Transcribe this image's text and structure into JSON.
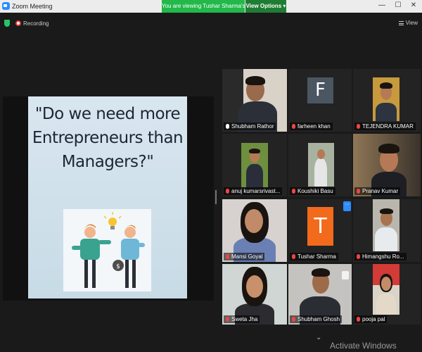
{
  "window": {
    "title": "Zoom Meeting",
    "controls": [
      "—",
      "☐",
      "✕"
    ]
  },
  "banner": {
    "viewing_text": "You are viewing Tushar Sharma's screen",
    "view_options_label": "View Options ▾"
  },
  "status": {
    "recording_label": "Recording",
    "view_label": "View"
  },
  "slide": {
    "lines": [
      "\"Do we need more",
      "Entrepreneurs than",
      "Managers?\""
    ]
  },
  "participants": [
    {
      "name": "Shubham Rathor",
      "active": true
    },
    {
      "name": "farheen khan",
      "avatar_letter": "F",
      "avatar_color": "#4a5662"
    },
    {
      "name": "TEJENDRA KUMAR"
    },
    {
      "name": "anuj kumarsrivast..."
    },
    {
      "name": "Koushiki Basu"
    },
    {
      "name": "Pranav Kumar"
    },
    {
      "name": "Mansi Goyal"
    },
    {
      "name": "Tushar Sharma",
      "avatar_letter": "T",
      "avatar_color": "#f26a1b"
    },
    {
      "name": "Himangshu Ro..."
    },
    {
      "name": "Sweta Jha"
    },
    {
      "name": "Shubham Ghosh"
    },
    {
      "name": "pooja pal"
    }
  ],
  "watermark": "Activate Windows",
  "colors": {
    "banner_green": "#22b84a",
    "active_border": "#cfe87a",
    "zoom_blue": "#2d8cff"
  }
}
